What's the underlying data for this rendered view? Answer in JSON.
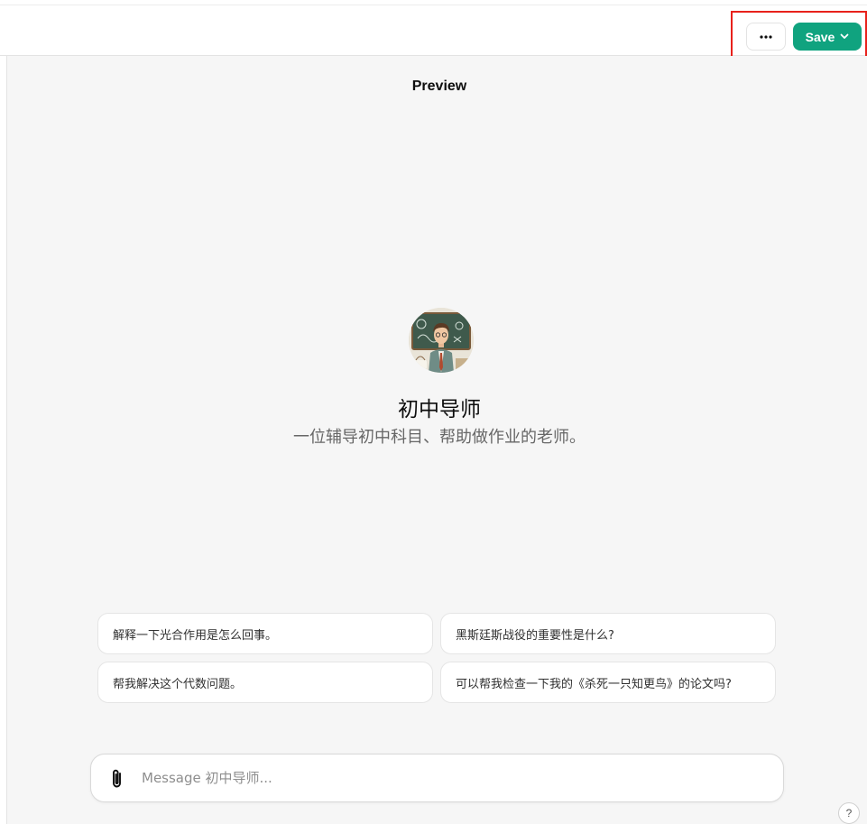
{
  "header": {
    "more_icon": "ellipsis-icon",
    "save_label": "Save",
    "save_icon": "chevron-down-icon",
    "save_color": "#10a37f",
    "highlight_color": "#e8211b"
  },
  "preview": {
    "title": "Preview",
    "avatar_icon": "teacher-avatar-image",
    "gpt_name": "初中导师",
    "gpt_description": "一位辅导初中科目、帮助做作业的老师。",
    "conversation_starters": [
      "解释一下光合作用是怎么回事。",
      "黑斯廷斯战役的重要性是什么?",
      "帮我解决这个代数问题。",
      "可以帮我检查一下我的《杀死一只知更鸟》的论文吗?"
    ]
  },
  "composer": {
    "attach_icon": "paperclip-icon",
    "placeholder": "Message 初中导师..."
  },
  "help": {
    "label": "?"
  }
}
